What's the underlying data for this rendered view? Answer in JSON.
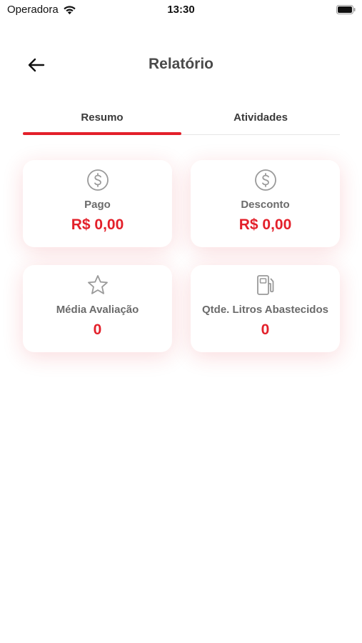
{
  "status_bar": {
    "carrier": "Operadora",
    "time": "13:30"
  },
  "header": {
    "title": "Relatório"
  },
  "tabs": [
    {
      "label": "Resumo",
      "active": true
    },
    {
      "label": "Atividades",
      "active": false
    }
  ],
  "cards": [
    {
      "icon": "dollar-circle-icon",
      "label": "Pago",
      "value": "R$ 0,00"
    },
    {
      "icon": "dollar-circle-icon",
      "label": "Desconto",
      "value": "R$ 0,00"
    },
    {
      "icon": "star-icon",
      "label": "Média Avaliação",
      "value": "0"
    },
    {
      "icon": "fuel-pump-icon",
      "label": "Qtde. Litros Abastecidos",
      "value": "0"
    }
  ],
  "colors": {
    "accent": "#e3202a",
    "title": "#4a4a4a",
    "label": "#6b6b6b",
    "icon": "#9a9a9a"
  }
}
